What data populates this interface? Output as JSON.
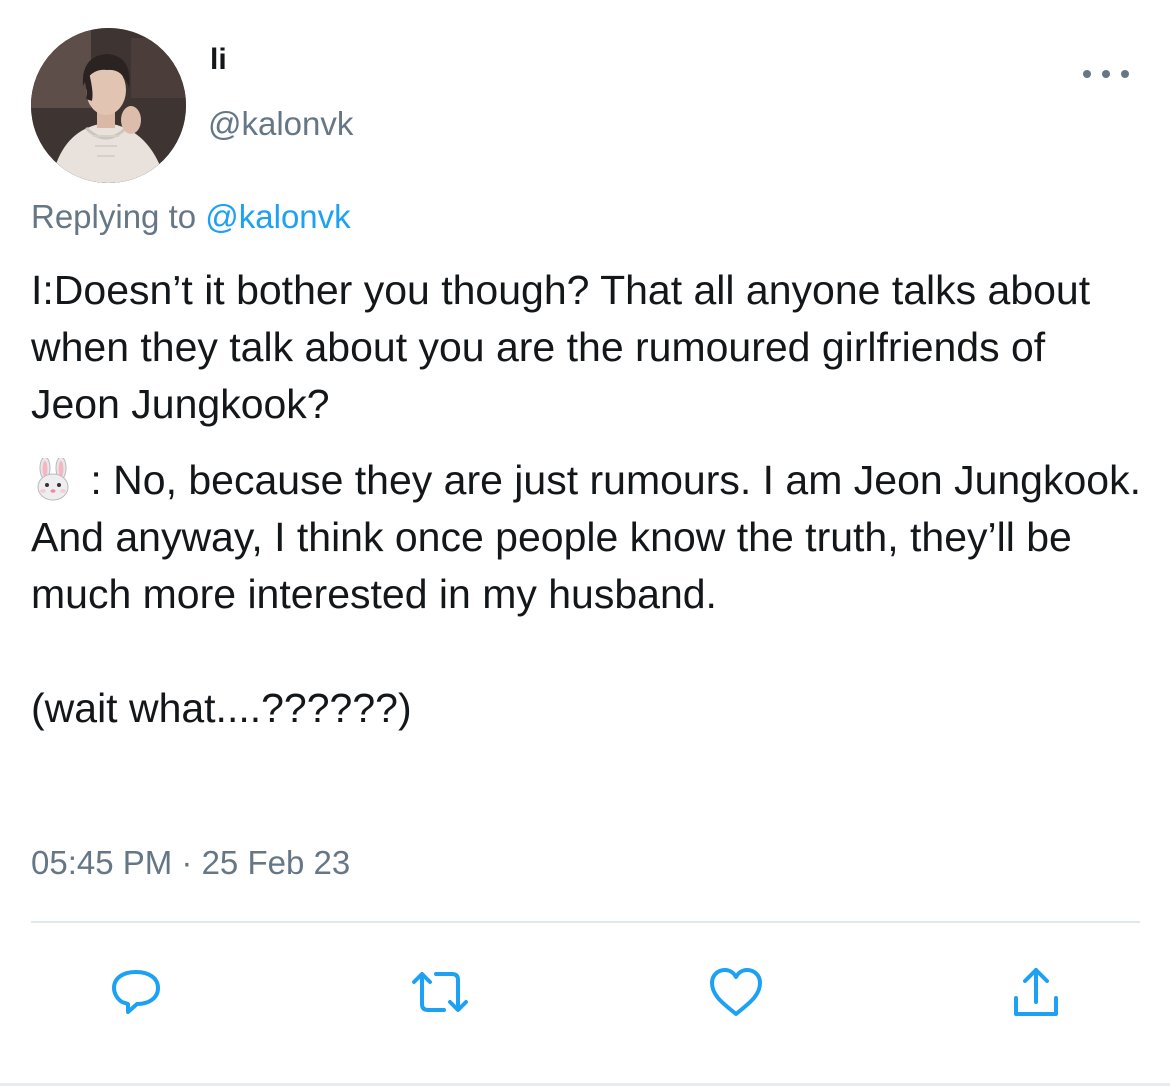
{
  "tweet": {
    "display_name": "li",
    "handle": "@kalonvk",
    "replying_prefix": "Replying to ",
    "replying_handle": "@kalonvk",
    "body": {
      "para1": "I:Doesn’t it bother you though? That all anyone talks about when they talk about you are the rumoured girlfriends of Jeon Jungkook?",
      "para2_emoji": "rabbit-face",
      "para2": " : No, because they are just rumours. I am Jeon Jungkook. And anyway, I think once people know the truth, they’ll be much more interested in my husband.",
      "para3": "(wait what....??????)"
    },
    "timestamp": "05:45 PM · 25 Feb 23"
  },
  "actions": {
    "reply_icon": "reply-icon",
    "retweet_icon": "retweet-icon",
    "like_icon": "heart-icon",
    "share_icon": "share-icon"
  },
  "colors": {
    "text": "#14171a",
    "secondary": "#657786",
    "link": "#1da1f2",
    "divider": "#e1e8ed"
  }
}
